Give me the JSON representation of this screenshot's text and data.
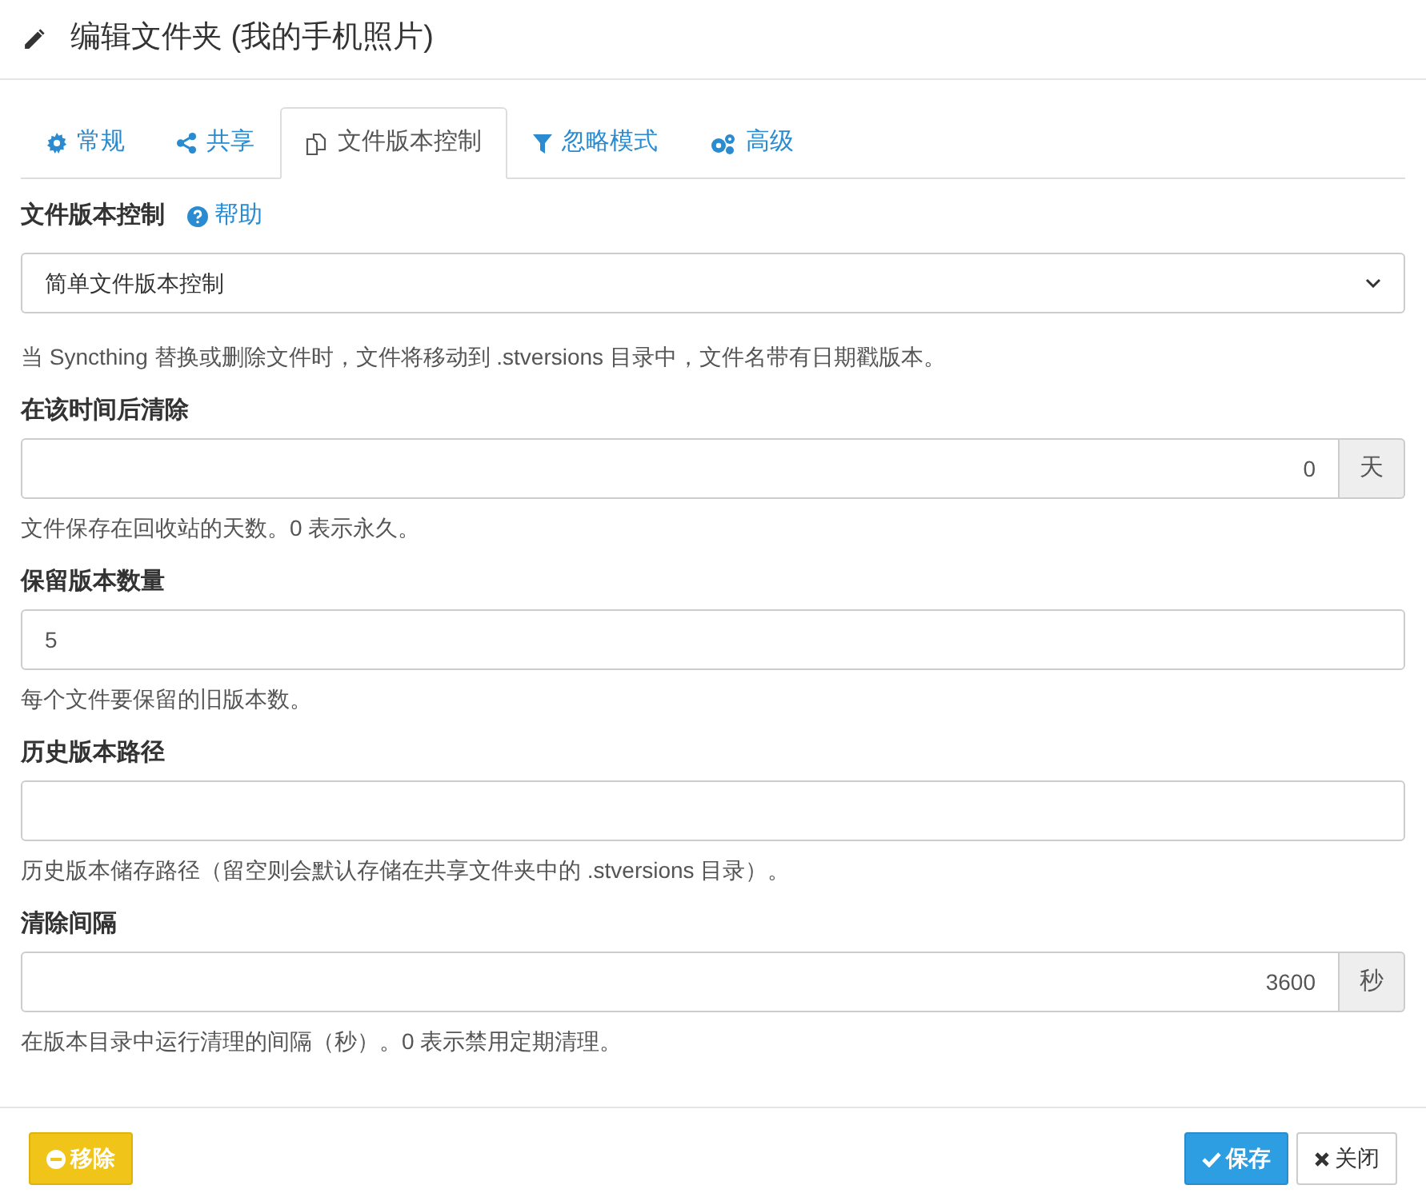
{
  "title": "编辑文件夹 (我的手机照片)",
  "tabs": [
    {
      "label": "常规",
      "selected": false
    },
    {
      "label": "共享",
      "selected": false
    },
    {
      "label": "文件版本控制",
      "selected": true
    },
    {
      "label": "忽略模式",
      "selected": false
    },
    {
      "label": "高级",
      "selected": false
    }
  ],
  "versioning": {
    "label": "文件版本控制",
    "help_link": "帮助",
    "value": "简单文件版本控制",
    "description": "当 Syncthing 替换或删除文件时，文件将移动到 .stversions 目录中，文件名带有日期戳版本。"
  },
  "fields": [
    {
      "kind": "number",
      "label": "在该时间后清除",
      "value": "0",
      "addon": "天",
      "help": "文件保存在回收站的天数。0 表示永久。"
    },
    {
      "kind": "text",
      "label": "保留版本数量",
      "value": "5",
      "help": "每个文件要保留的旧版本数。"
    },
    {
      "kind": "text",
      "label": "历史版本路径",
      "help": "历史版本储存路径（留空则会默认存储在共享文件夹中的 .stversions 目录）。"
    },
    {
      "kind": "number",
      "label": "清除间隔",
      "value": "3600",
      "addon": "秒",
      "help": "在版本目录中运行清理的间隔（秒）。0 表示禁用定期清理。"
    }
  ],
  "buttons": [
    {
      "kind": "warning",
      "label": "移除"
    },
    {
      "kind": "primary",
      "label": "保存"
    },
    {
      "kind": "default",
      "label": "关闭"
    }
  ]
}
